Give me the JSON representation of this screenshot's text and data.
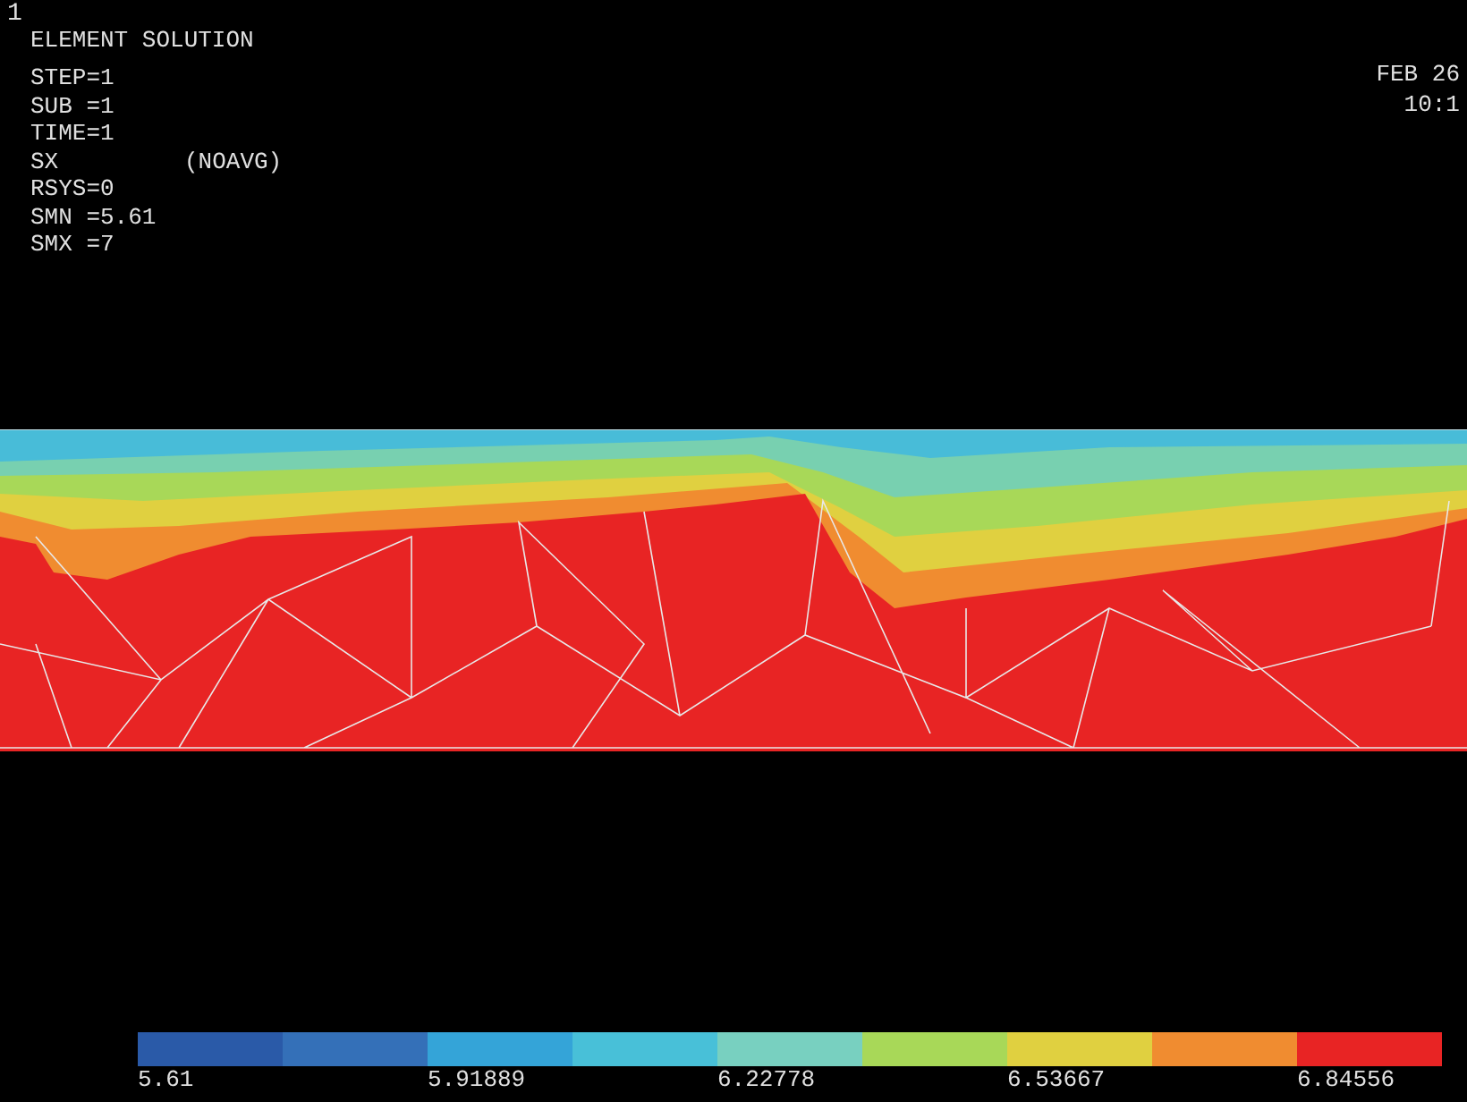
{
  "window_number": "1",
  "header": {
    "title": "ELEMENT SOLUTION",
    "lines": [
      {
        "label": "STEP=1"
      },
      {
        "label": "SUB =1"
      },
      {
        "label": "TIME=1"
      },
      {
        "label": "SX",
        "note": "(NOAVG)"
      },
      {
        "label": "RSYS=0"
      },
      {
        "label": "SMN =5.61"
      },
      {
        "label": "SMX =7"
      }
    ]
  },
  "timestamp": {
    "date": "FEB 26",
    "time": "10:1"
  },
  "legend": {
    "bands": [
      {
        "color": "#2a5aa8"
      },
      {
        "color": "#3470b8"
      },
      {
        "color": "#34a4d8"
      },
      {
        "color": "#48c0d8"
      },
      {
        "color": "#78d0c0"
      },
      {
        "color": "#a8d858"
      },
      {
        "color": "#e0d040"
      },
      {
        "color": "#f08c30"
      },
      {
        "color": "#e82424"
      }
    ],
    "labels": [
      "5.61",
      "5.91889",
      "6.22778",
      "6.53667",
      "6.84556"
    ]
  }
}
